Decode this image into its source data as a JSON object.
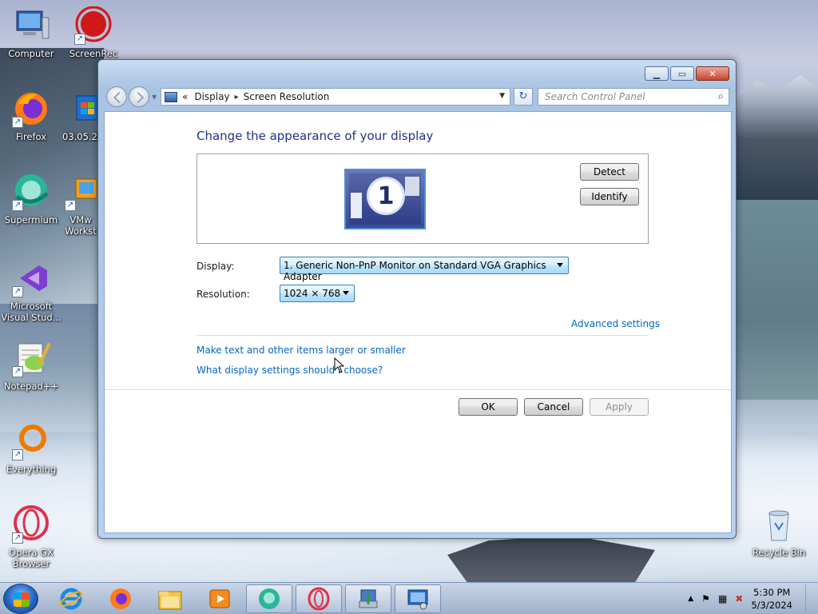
{
  "desktop": {
    "icons": [
      {
        "label": "Computer"
      },
      {
        "label": "ScreenRec"
      },
      {
        "label": "Firefox"
      },
      {
        "label": "03.05.20"
      },
      {
        "label": "Supermium"
      },
      {
        "label": "VMw Workst"
      },
      {
        "label": "Microsoft Visual Stud..."
      },
      {
        "label": "Notepad++"
      },
      {
        "label": "Everything"
      },
      {
        "label": "Opera GX Browser"
      },
      {
        "label": "Recycle Bin"
      }
    ]
  },
  "window": {
    "caption": {
      "minimize": "▁",
      "maximize": "▭",
      "close": "✕"
    },
    "nav": {
      "breadcrumb_prefix": "«",
      "crumbs": [
        "Display",
        "Screen Resolution"
      ],
      "crumb_separator": "▸",
      "refresh_glyph": "↻",
      "search_placeholder": "Search Control Panel"
    },
    "heading": "Change the appearance of your display",
    "monitor_number": "1",
    "detect_button": "Detect",
    "identify_button": "Identify",
    "display_label": "Display:",
    "display_value": "1. Generic Non-PnP Monitor on Standard VGA Graphics Adapter",
    "resolution_label": "Resolution:",
    "resolution_value": "1024 × 768",
    "advanced_link": "Advanced settings",
    "links": [
      "Make text and other items larger or smaller",
      "What display settings should I choose?"
    ],
    "ok_button": "OK",
    "cancel_button": "Cancel",
    "apply_button": "Apply"
  },
  "taskbar": {
    "time": "5:30 PM",
    "date": "5/3/2024"
  },
  "colors": {
    "heading": "#1e3287",
    "link": "#0066cc",
    "combo_border": "#3c7fb1"
  }
}
